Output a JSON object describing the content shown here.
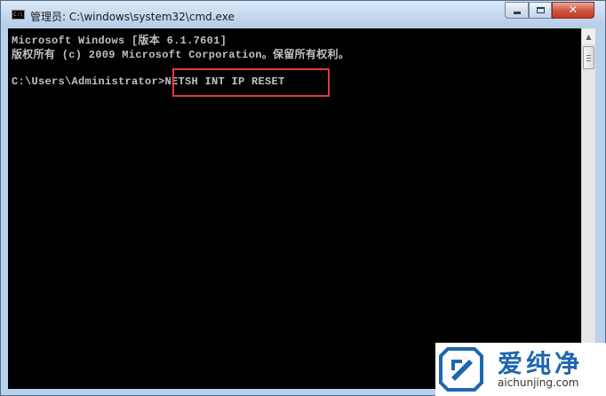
{
  "window": {
    "title": "管理员: C:\\windows\\system32\\cmd.exe",
    "icon": "cmd-icon",
    "icon_text": "C:\\"
  },
  "console": {
    "lines": [
      "Microsoft Windows [版本 6.1.7601]",
      "版权所有 (c) 2009 Microsoft Corporation。保留所有权利。"
    ],
    "prompt": "C:\\Users\\Administrator>",
    "command": "NETSH INT IP RESET",
    "text_color": "#c0c0c0",
    "background_color": "#000000",
    "highlight_color": "#e0393e"
  },
  "watermark": {
    "title": "爱纯净",
    "url": "aichunjing.com",
    "color": "#1f66b0"
  }
}
